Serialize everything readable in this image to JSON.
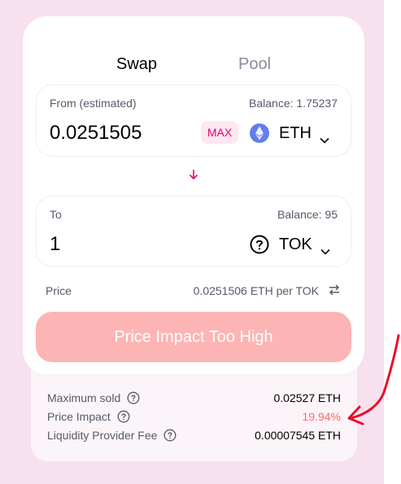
{
  "tabs": {
    "swap": "Swap",
    "pool": "Pool"
  },
  "from": {
    "label": "From (estimated)",
    "balance": "Balance: 1.75237",
    "amount": "0.0251505",
    "max_label": "MAX",
    "token": "ETH",
    "token_icon": "ethereum-icon"
  },
  "to": {
    "label": "To",
    "balance": "Balance: 95",
    "amount": "1",
    "token": "TOK",
    "token_icon": "unknown-token-icon"
  },
  "price": {
    "label": "Price",
    "value": "0.0251506 ETH per TOK"
  },
  "action_button": "Price Impact Too High",
  "details": {
    "maximum_sold_label": "Maximum sold",
    "maximum_sold_value": "0.02527 ETH",
    "price_impact_label": "Price Impact",
    "price_impact_value": "19.94%",
    "lp_fee_label": "Liquidity Provider Fee",
    "lp_fee_value": "0.00007545 ETH"
  },
  "colors": {
    "accent_pink": "#e8006f",
    "button_disabled": "#fdb4b4",
    "warning_red": "#ff6871",
    "annotation_red": "#e8102a",
    "eth_blue": "#627eea"
  }
}
